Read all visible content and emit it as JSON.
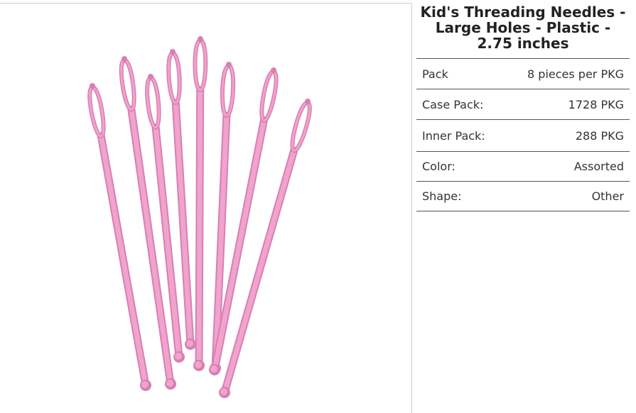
{
  "product": {
    "title": "Kid's Threading Needles - Large Holes - Plastic - 2.75 inches",
    "image": {
      "subject": "needles-image",
      "needle_color": "#f0a3cc",
      "needle_outline": "#d97fb2"
    }
  },
  "specs": [
    {
      "label": "Pack",
      "value": "8 pieces per PKG"
    },
    {
      "label": "Case Pack:",
      "value": "1728 PKG"
    },
    {
      "label": "Inner Pack:",
      "value": "288 PKG"
    },
    {
      "label": "Color:",
      "value": "Assorted"
    },
    {
      "label": "Shape:",
      "value": "Other"
    }
  ]
}
